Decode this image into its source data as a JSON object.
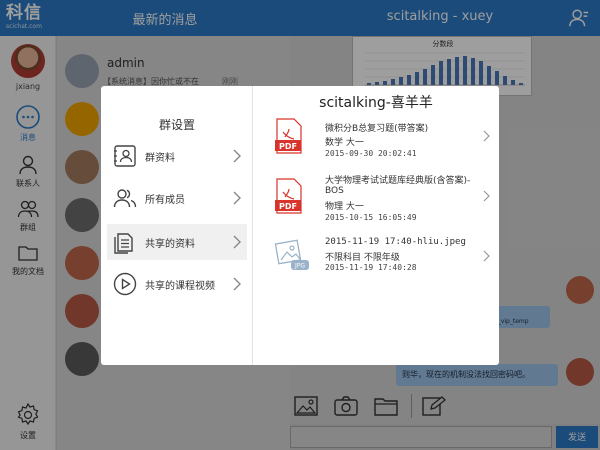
{
  "app": {
    "logo_text": "科信",
    "logo_url": "scichat.com",
    "left_title": "最新的消息",
    "right_title": "scitalking - xuey"
  },
  "sidebar": {
    "user_name": "jxiang",
    "items": [
      {
        "label": "消息",
        "icon": "chat-bubble-icon"
      },
      {
        "label": "联系人",
        "icon": "person-icon"
      },
      {
        "label": "群组",
        "icon": "group-icon"
      },
      {
        "label": "我的文档",
        "icon": "folder-icon"
      },
      {
        "label": "设置",
        "icon": "gear-icon"
      }
    ]
  },
  "message_list": {
    "first": {
      "name": "admin",
      "preview": "【系统消息】因你忙或不在",
      "time": "刚刚"
    }
  },
  "chat": {
    "chart_title": "分数段",
    "bubble_a": "_tab_vip_temp",
    "bubble_b": "则华，现在的机制没法找回密码吧。",
    "send_label": "发送"
  },
  "modal": {
    "left_title": "群设置",
    "menu": [
      {
        "label": "群资料",
        "icon": "id-card-icon"
      },
      {
        "label": "所有成员",
        "icon": "members-icon"
      },
      {
        "label": "共享的资料",
        "icon": "shared-docs-icon"
      },
      {
        "label": "共享的课程视频",
        "icon": "play-icon"
      }
    ],
    "active_menu": "共享的资料",
    "right_title": "scitalking-喜羊羊",
    "files": [
      {
        "type": "pdf",
        "title": "微积分B总复习题(带答案)",
        "meta": "数学    大一",
        "date": "2015-09-30 20:02:41"
      },
      {
        "type": "pdf",
        "title": "大学物理考试试题库经典版(含答案)-",
        "title2": "BOS",
        "meta": "物理    大一",
        "date": "2015-10-15 16:05:49"
      },
      {
        "type": "jpeg",
        "title": "2015-11-19 17:40-hliu.jpeg",
        "meta": "不限科目    不限年级",
        "date": "2015-11-19 17:40:28"
      }
    ]
  },
  "colors": {
    "brand": "#2b79c6",
    "pdf_red": "#d9342b"
  }
}
